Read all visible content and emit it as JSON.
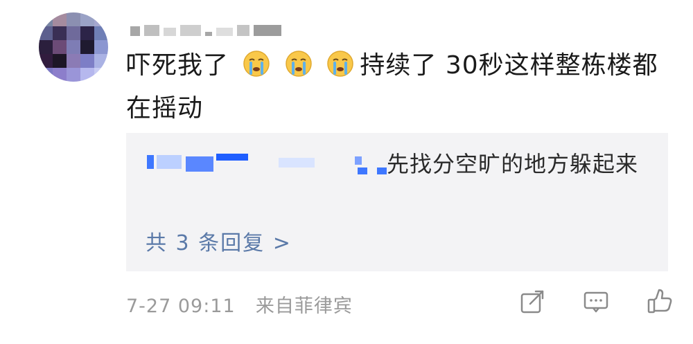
{
  "comment": {
    "text_before_emoji": "吓死我了",
    "text_after_emoji": "持续了 30秒这样整栋楼都在摇动",
    "emojis": [
      "crying-face",
      "crying-face",
      "crying-face"
    ]
  },
  "reply": {
    "text": "先找分空旷的地方躲起来",
    "count_label": "共 3 条回复 >"
  },
  "meta": {
    "timestamp": "7-27 09:11",
    "source": "来自菲律宾"
  },
  "actions": {
    "share_icon": "share-icon",
    "comment_icon": "comment-icon",
    "like_icon": "thumbs-up-icon"
  },
  "colors": {
    "reply_bg": "#f3f3f5",
    "link_blue": "#5a79a8",
    "meta_gray": "#9a9a9a"
  }
}
